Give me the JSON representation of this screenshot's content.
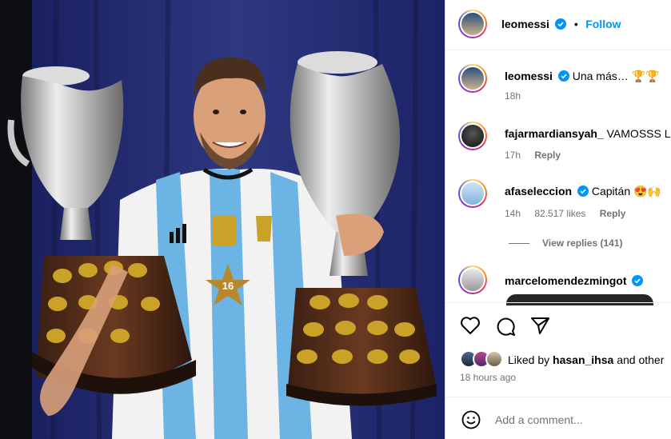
{
  "post": {
    "photo_alt_icon": "photo-icon",
    "jersey_number": "16"
  },
  "header": {
    "username": "leomessi",
    "separator": "•",
    "follow_label": "Follow"
  },
  "comments": [
    {
      "username": "leomessi",
      "text": "Una más… 🏆🏆",
      "time": "18h",
      "likes": "",
      "reply": "",
      "verified": true
    },
    {
      "username": "fajarmardiansyah_",
      "text": "VAMOSSS L",
      "time": "17h",
      "likes": "",
      "reply": "Reply",
      "verified": false
    },
    {
      "username": "afaseleccion",
      "text": "Capitán 😍🙌",
      "time": "14h",
      "likes": "82.517 likes",
      "reply": "Reply",
      "verified": true
    },
    {
      "username": "marcelomendezmingot",
      "text": "",
      "time": "",
      "likes": "",
      "reply": "",
      "verified": true
    }
  ],
  "view_replies": "View replies (141)",
  "actions": {
    "like_icon": "heart-icon",
    "comment_icon": "comment-icon",
    "share_icon": "share-icon"
  },
  "liked_by": {
    "prefix": "Liked by ",
    "user": "hasan_ihsa",
    "suffix": " and other"
  },
  "time_ago": "18 hours ago",
  "add_comment": {
    "placeholder": "Add a comment..."
  },
  "colors": {
    "accent": "#0095f6",
    "verified": "#0095f6",
    "jersey_blue": "#6cb4e4"
  }
}
